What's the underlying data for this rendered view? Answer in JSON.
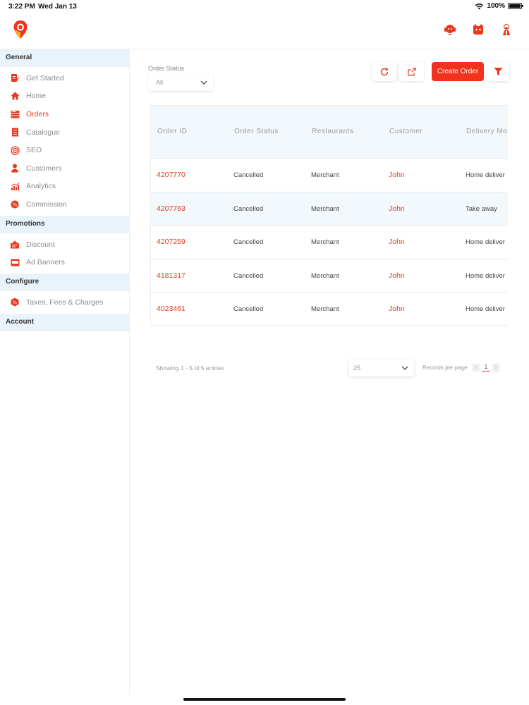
{
  "status_bar": {
    "time": "3:22 PM",
    "date": "Wed Jan 13",
    "battery": "100%"
  },
  "header": {
    "icons": [
      "support-agent-icon",
      "notification-icon",
      "user-profile-icon"
    ]
  },
  "sidebar": {
    "sections": [
      {
        "title": "General",
        "items": [
          {
            "label": "Get Started",
            "icon": "document-edit-icon"
          },
          {
            "label": "Home",
            "icon": "home-icon"
          },
          {
            "label": "Orders",
            "icon": "orders-icon",
            "active": true
          },
          {
            "label": "Catalogue",
            "icon": "catalogue-icon"
          },
          {
            "label": "SEO",
            "icon": "target-icon"
          },
          {
            "label": "Customers",
            "icon": "person-icon"
          },
          {
            "label": "Analytics",
            "icon": "analytics-icon"
          },
          {
            "label": "Commission",
            "icon": "percent-icon"
          }
        ]
      },
      {
        "title": "Promotions",
        "items": [
          {
            "label": "Discount",
            "icon": "discount-icon"
          },
          {
            "label": "Ad Banners",
            "icon": "banner-icon"
          }
        ]
      },
      {
        "title": "Configure",
        "items": [
          {
            "label": "Taxes, Fees & Charges",
            "icon": "tax-icon"
          }
        ]
      },
      {
        "title": "Account",
        "items": []
      }
    ]
  },
  "filters": {
    "order_status_label": "Order Status",
    "order_status_value": "All"
  },
  "toolbar": {
    "create_order_label": "Create Order"
  },
  "table": {
    "columns": [
      "Order ID",
      "Order Status",
      "Restaurants",
      "Customer",
      "Delivery Mo"
    ],
    "rows": [
      {
        "order_id": "4207770",
        "status": "Cancelled",
        "restaurant": "Merchant",
        "customer": "John",
        "delivery": "Home deliver"
      },
      {
        "order_id": "4207763",
        "status": "Cancelled",
        "restaurant": "Merchant",
        "customer": "John",
        "delivery": "Take away"
      },
      {
        "order_id": "4207259",
        "status": "Cancelled",
        "restaurant": "Merchant",
        "customer": "John",
        "delivery": "Home deliver"
      },
      {
        "order_id": "4181317",
        "status": "Cancelled",
        "restaurant": "Merchant",
        "customer": "John",
        "delivery": "Home deliver"
      },
      {
        "order_id": "4023461",
        "status": "Cancelled",
        "restaurant": "Merchant",
        "customer": "John",
        "delivery": "Home deliver"
      }
    ]
  },
  "pagination": {
    "showing_text": "Showing 1 - 5 of 5 entries",
    "per_page_value": "25",
    "per_page_label": "Records per page",
    "current_page": "1"
  },
  "colors": {
    "accent": "#e8391f",
    "button": "#f2321c",
    "section_bg": "#e9f3fb",
    "table_header_bg": "#f3f8fc"
  }
}
